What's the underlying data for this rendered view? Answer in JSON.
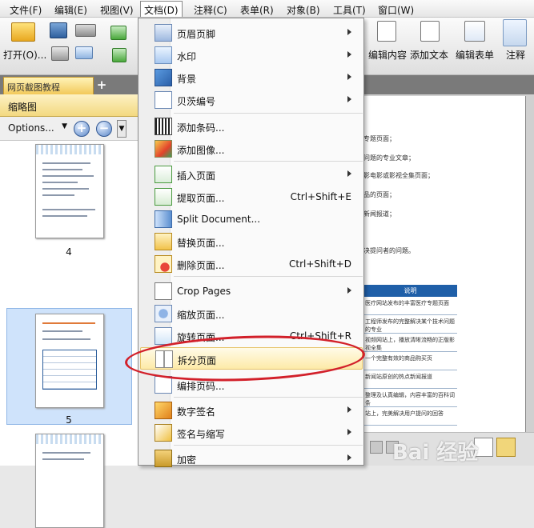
{
  "menubar": {
    "items": [
      "文件(F)",
      "编辑(E)",
      "视图(V)",
      "文档(D)",
      "注释(C)",
      "表单(R)",
      "对象(B)",
      "工具(T)",
      "窗口(W)"
    ]
  },
  "toolbar": {
    "open_label": "打开(O)...",
    "edit_content_label": "编辑内容",
    "add_text_label": "添加文本",
    "edit_form_label": "编辑表单",
    "annotate_label": "注释"
  },
  "tab": {
    "title": "网页截图教程"
  },
  "sidepanel": {
    "title": "缩略图",
    "options_label": "Options...",
    "zoom_in": "+",
    "zoom_out": "−",
    "pages": [
      "4",
      "5"
    ]
  },
  "document": {
    "lines": [
      "专题页面；",
      "问题的专业文章；",
      "影电影或影视全集页面；",
      "品的页面；",
      "新闻报道；",
      "",
      "决提问者的问题。"
    ],
    "table_header": "说明",
    "table_rows": [
      "医疗网站发布的丰富医疗专题页面",
      "工程师发布的完整解决某个技术问题的专业",
      "视频网站上，播放清晰流畅的正版影视全集",
      "一个完整有效的商品购买页",
      "新闻站原创的热点新闻报道",
      "整理及认真编辑，内容丰富的百科词条",
      "站上，完美解决用户提问的回答"
    ]
  },
  "menu": {
    "items": [
      {
        "label": "页眉页脚",
        "shortcut": "",
        "submenu": true,
        "icon": "header-footer-icon"
      },
      {
        "label": "水印",
        "shortcut": "",
        "submenu": true,
        "icon": "watermark-icon"
      },
      {
        "label": "背景",
        "shortcut": "",
        "submenu": true,
        "icon": "background-icon"
      },
      {
        "label": "贝茨编号",
        "shortcut": "",
        "submenu": true,
        "icon": "bates-number-icon"
      },
      {
        "label": "添加条码...",
        "shortcut": "",
        "submenu": false,
        "icon": "barcode-icon"
      },
      {
        "label": "添加图像...",
        "shortcut": "",
        "submenu": false,
        "icon": "add-image-icon"
      },
      {
        "label": "插入页面",
        "shortcut": "",
        "submenu": true,
        "icon": "insert-page-icon"
      },
      {
        "label": "提取页面...",
        "shortcut": "Ctrl+Shift+E",
        "submenu": false,
        "icon": "extract-page-icon"
      },
      {
        "label": "Split Document...",
        "shortcut": "",
        "submenu": false,
        "icon": "split-document-icon"
      },
      {
        "label": "替换页面...",
        "shortcut": "",
        "submenu": false,
        "icon": "replace-page-icon"
      },
      {
        "label": "删除页面...",
        "shortcut": "Ctrl+Shift+D",
        "submenu": false,
        "icon": "delete-page-icon"
      },
      {
        "label": "Crop Pages",
        "shortcut": "",
        "submenu": true,
        "icon": "crop-pages-icon"
      },
      {
        "label": "缩放页面...",
        "shortcut": "",
        "submenu": false,
        "icon": "scale-page-icon"
      },
      {
        "label": "旋转页面...",
        "shortcut": "Ctrl+Shift+R",
        "submenu": false,
        "icon": "rotate-page-icon"
      },
      {
        "label": "拆分页面",
        "shortcut": "",
        "submenu": false,
        "icon": "split-page-icon"
      },
      {
        "label": "编排页码...",
        "shortcut": "",
        "submenu": false,
        "icon": "page-numbering-icon"
      },
      {
        "label": "数字签名",
        "shortcut": "",
        "submenu": true,
        "icon": "digital-signature-icon"
      },
      {
        "label": "签名与缩写",
        "shortcut": "",
        "submenu": true,
        "icon": "sign-initials-icon"
      },
      {
        "label": "加密",
        "shortcut": "",
        "submenu": true,
        "icon": "encrypt-icon"
      }
    ]
  },
  "status": {
    "watermark": "Bai 经验"
  }
}
